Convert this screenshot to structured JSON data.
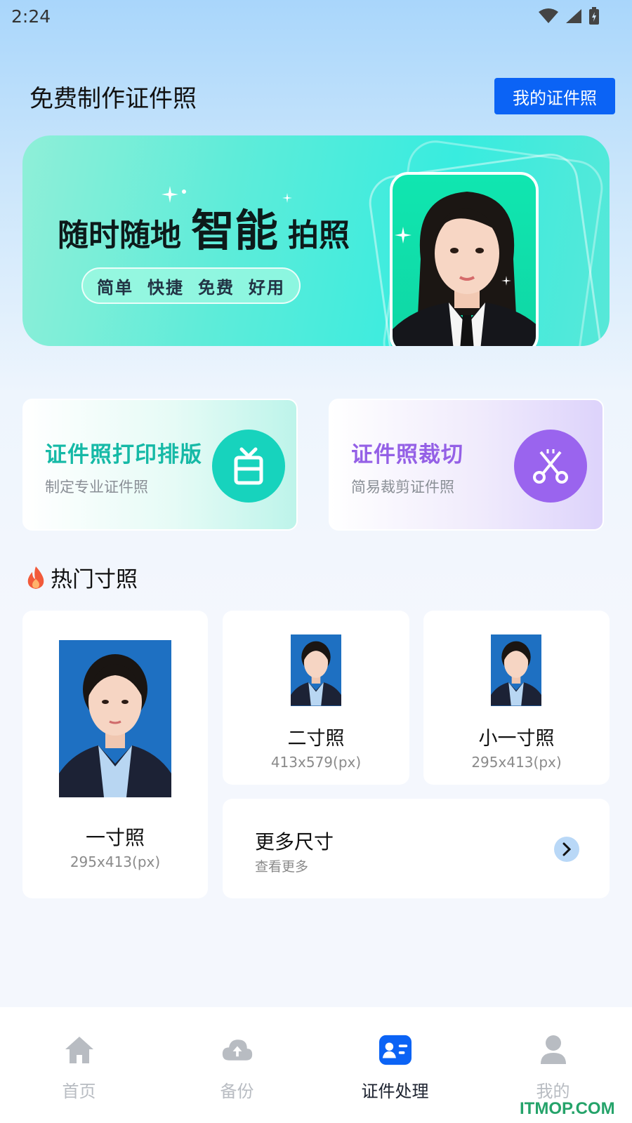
{
  "status_bar": {
    "time": "2:24"
  },
  "header": {
    "title": "免费制作证件照",
    "my_photos_label": "我的证件照"
  },
  "banner": {
    "headline_a": "随时随地",
    "headline_b": "智能",
    "headline_c": "拍照",
    "tags": [
      "简单",
      "快捷",
      "免费",
      "好用"
    ]
  },
  "features": [
    {
      "title": "证件照打印排版",
      "subtitle": "制定专业证件照",
      "icon": "print-layout-icon",
      "color": "#15b9a6"
    },
    {
      "title": "证件照裁切",
      "subtitle": "简易裁剪证件照",
      "icon": "scissors-icon",
      "color": "#9460e6"
    }
  ],
  "popular": {
    "title": "热门寸照",
    "icon": "flame-icon",
    "sizes": [
      {
        "name": "一寸照",
        "dims": "295x413(px)"
      },
      {
        "name": "二寸照",
        "dims": "413x579(px)"
      },
      {
        "name": "小一寸照",
        "dims": "295x413(px)"
      }
    ],
    "more": {
      "title": "更多尺寸",
      "subtitle": "查看更多"
    }
  },
  "nav": {
    "items": [
      {
        "label": "首页",
        "icon": "home-icon"
      },
      {
        "label": "备份",
        "icon": "cloud-icon"
      },
      {
        "label": "证件处理",
        "icon": "id-card-icon",
        "active": true
      },
      {
        "label": "我的",
        "icon": "user-icon"
      }
    ]
  },
  "watermark": "ITMOP.COM",
  "colors": {
    "accent": "#0b63f5",
    "teal": "#17d3bd",
    "purple": "#9a64ee"
  }
}
